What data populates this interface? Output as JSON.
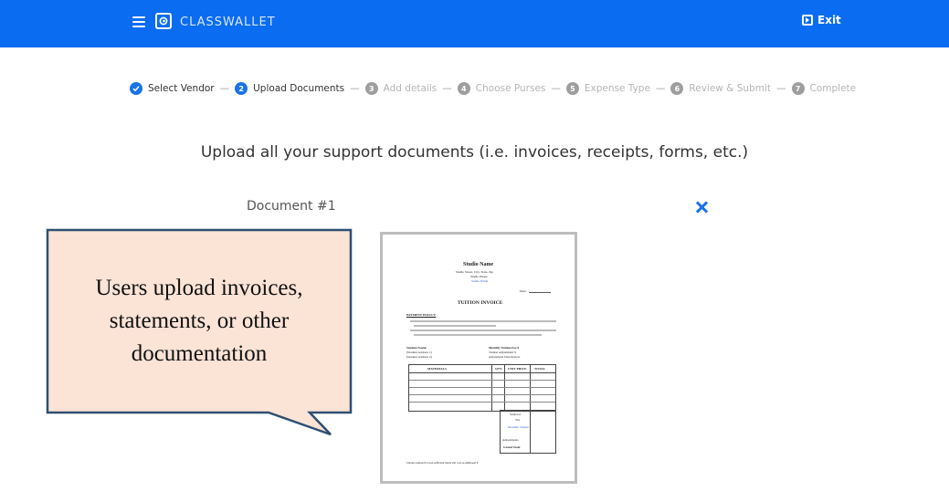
{
  "header": {
    "brand": "CLASSWALLET",
    "exit_label": "Exit",
    "top_link_fragment": "p"
  },
  "stepper": {
    "steps": [
      {
        "number": "1",
        "label": "Select Vendor",
        "state": "done"
      },
      {
        "number": "2",
        "label": "Upload Documents",
        "state": "current"
      },
      {
        "number": "3",
        "label": "Add details",
        "state": "pending"
      },
      {
        "number": "4",
        "label": "Choose Purses",
        "state": "pending"
      },
      {
        "number": "5",
        "label": "Expense Type",
        "state": "pending"
      },
      {
        "number": "6",
        "label": "Review & Submit",
        "state": "pending"
      },
      {
        "number": "7",
        "label": "Complete",
        "state": "pending"
      }
    ],
    "separator": "—"
  },
  "main": {
    "heading": "Upload all your support documents (i.e. invoices, receipts, forms, etc.)",
    "document_label": "Document #1"
  },
  "callout": {
    "text_line1": "Users upload invoices,",
    "text_line2": "statements, or other",
    "text_line3": "documentation"
  },
  "preview": {
    "studio_name": "Studio Name",
    "address": "Studio Street, City, State, Zip",
    "phone": "Studio Phone",
    "email": "Studio Email",
    "date_label": "Date:",
    "title": "TUITION INVOICE",
    "policy_label": "PAYMENT POLICY:",
    "student_name": "Student Name:",
    "student_address1": "(Student Address 1)",
    "student_address2": "(Student Address 2)",
    "monthly_tuition": "Monthly Tuition Fee $",
    "tuition_adjustment": "Tuition Adjustment $",
    "adjustment_desc": "Adjustment Description:",
    "col_materials": "MATERIALS",
    "col_qty": "QTY.",
    "col_unit": "UNIT PRICE",
    "col_total": "TOTAL",
    "subtotal": "Subtotal",
    "tax": "Tax",
    "monthly": "Monthly Tuition",
    "adjustments": "Adjustments",
    "grand_total": "Grand Total",
    "footer": "Checks returned for non-sufficient funds will cost an additional $"
  },
  "colors": {
    "topbar": "#0a6cf0",
    "accent": "#1a73e8",
    "callout_fill": "#fbe3d6",
    "callout_border": "#2f4f72"
  },
  "icons": {
    "menu": "hamburger-icon",
    "logo": "classwallet-logo-icon",
    "exit": "exit-icon",
    "remove": "close-icon",
    "step_done": "check-circle-icon"
  }
}
